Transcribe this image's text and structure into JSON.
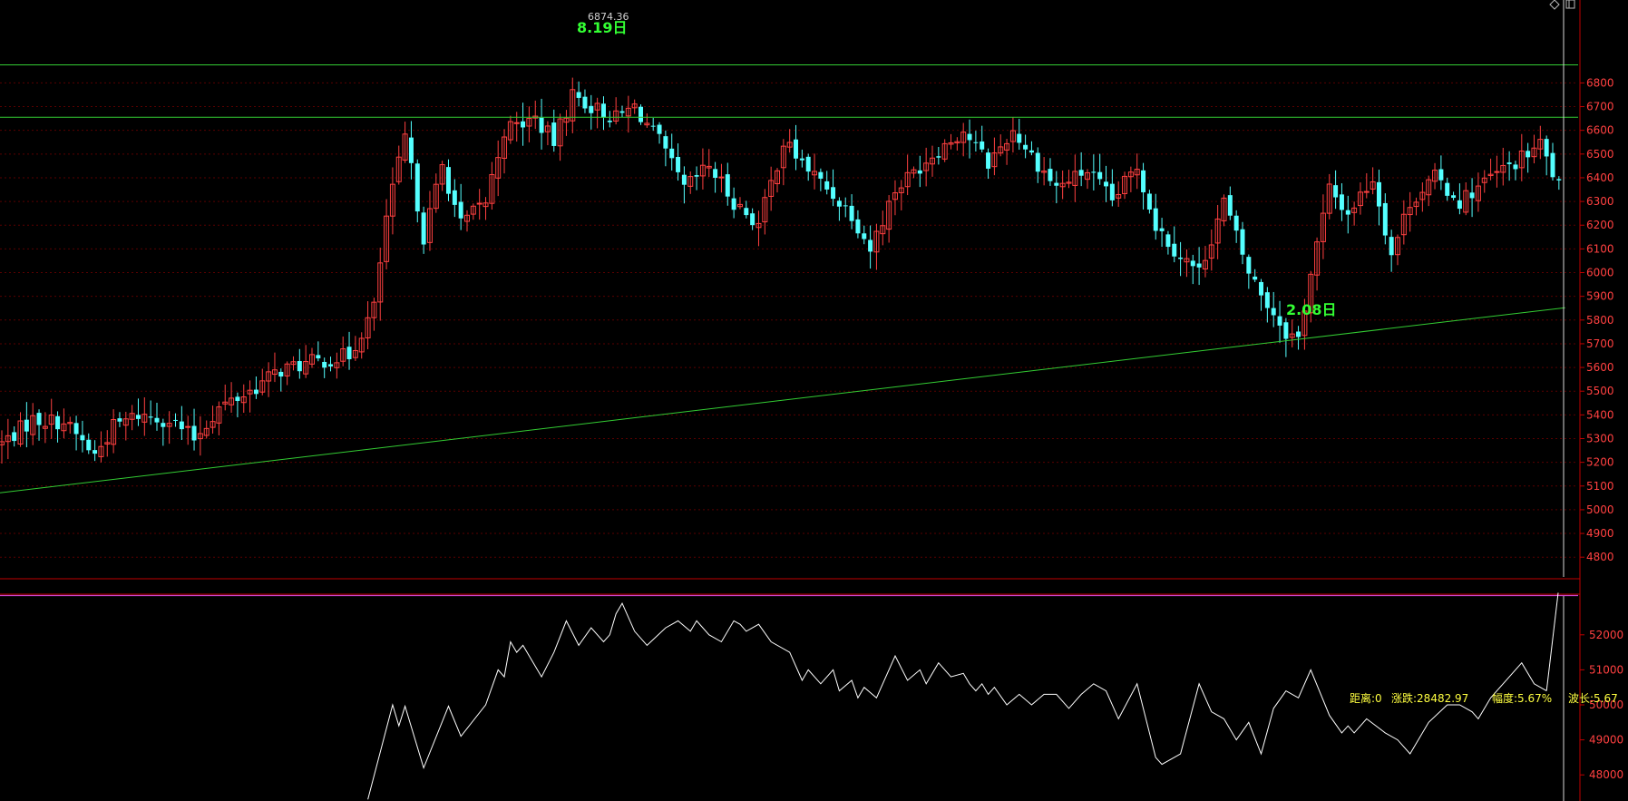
{
  "colors": {
    "background": "#000000",
    "up_candle": "#ff4040",
    "down_candle": "#54ffff",
    "grid": "#5a0000",
    "axis": "#c00000",
    "trend_line": "#33cc33",
    "osc_line": "#ffffff",
    "osc_band": "#cc44cc",
    "tick_text": "#ff4040",
    "annotation": "#33ff33",
    "info_text": "#ffff40"
  },
  "chart_data": [
    {
      "type": "candlestick",
      "y_ticks": [
        4800,
        4900,
        5000,
        5100,
        5200,
        5300,
        5400,
        5500,
        5600,
        5700,
        5800,
        5900,
        6000,
        6100,
        6200,
        6300,
        6400,
        6500,
        6600,
        6700,
        6800
      ],
      "ylim": [
        4570,
        6910
      ],
      "grid": true,
      "annotations": [
        {
          "date_label": "8.19日",
          "price_label": "6874.36",
          "bar_index": 93,
          "price": 6874.36
        },
        {
          "date_label": "2.08日",
          "bar_index": 209,
          "price": 5720
        }
      ],
      "horizontal_lines": [
        6876,
        6655
      ],
      "trend_line": {
        "from": {
          "bar_index": -2,
          "value": 5066
        },
        "to": {
          "bar_index": 252,
          "value": 5852
        }
      },
      "candles": {
        "count": 252,
        "keypoints": [
          [
            0,
            5280
          ],
          [
            5,
            5380
          ],
          [
            10,
            5370
          ],
          [
            15,
            5230
          ],
          [
            18,
            5350
          ],
          [
            22,
            5400
          ],
          [
            27,
            5380
          ],
          [
            31,
            5300
          ],
          [
            35,
            5430
          ],
          [
            40,
            5500
          ],
          [
            45,
            5590
          ],
          [
            50,
            5620
          ],
          [
            56,
            5650
          ],
          [
            60,
            5850
          ],
          [
            62,
            6230
          ],
          [
            65,
            6570
          ],
          [
            68,
            6150
          ],
          [
            71,
            6450
          ],
          [
            74,
            6200
          ],
          [
            78,
            6300
          ],
          [
            81,
            6600
          ],
          [
            86,
            6650
          ],
          [
            89,
            6550
          ],
          [
            92,
            6750
          ],
          [
            95,
            6700
          ],
          [
            99,
            6650
          ],
          [
            102,
            6700
          ],
          [
            106,
            6550
          ],
          [
            110,
            6350
          ],
          [
            114,
            6450
          ],
          [
            118,
            6300
          ],
          [
            122,
            6200
          ],
          [
            126,
            6550
          ],
          [
            132,
            6380
          ],
          [
            137,
            6250
          ],
          [
            140,
            6100
          ],
          [
            144,
            6350
          ],
          [
            150,
            6500
          ],
          [
            155,
            6600
          ],
          [
            159,
            6460
          ],
          [
            163,
            6600
          ],
          [
            167,
            6460
          ],
          [
            170,
            6360
          ],
          [
            175,
            6430
          ],
          [
            179,
            6300
          ],
          [
            183,
            6450
          ],
          [
            186,
            6200
          ],
          [
            189,
            6100
          ],
          [
            193,
            6000
          ],
          [
            197,
            6300
          ],
          [
            201,
            6000
          ],
          [
            204,
            5870
          ],
          [
            207,
            5750
          ],
          [
            209,
            5720
          ],
          [
            211,
            6000
          ],
          [
            214,
            6350
          ],
          [
            217,
            6250
          ],
          [
            221,
            6400
          ],
          [
            224,
            6080
          ],
          [
            227,
            6300
          ],
          [
            231,
            6400
          ],
          [
            235,
            6300
          ],
          [
            240,
            6400
          ],
          [
            245,
            6480
          ],
          [
            248,
            6540
          ],
          [
            251,
            6360
          ]
        ]
      }
    },
    {
      "type": "line",
      "y_ticks": [
        48000,
        49000,
        50000,
        51000,
        52000
      ],
      "ylim": [
        47200,
        53200
      ],
      "reference_line": 53200,
      "points": [
        [
          59,
          47300
        ],
        [
          63,
          50000
        ],
        [
          64,
          49400
        ],
        [
          65,
          49960
        ],
        [
          68,
          48200
        ],
        [
          72,
          49960
        ],
        [
          74,
          49100
        ],
        [
          78,
          50000
        ],
        [
          80,
          51000
        ],
        [
          81,
          50800
        ],
        [
          82,
          51800
        ],
        [
          83,
          51500
        ],
        [
          84,
          51700
        ],
        [
          87,
          50800
        ],
        [
          89,
          51500
        ],
        [
          91,
          52400
        ],
        [
          93,
          51700
        ],
        [
          95,
          52200
        ],
        [
          97,
          51800
        ],
        [
          98,
          52000
        ],
        [
          99,
          52600
        ],
        [
          100,
          52900
        ],
        [
          102,
          52100
        ],
        [
          104,
          51700
        ],
        [
          107,
          52200
        ],
        [
          109,
          52400
        ],
        [
          111,
          52100
        ],
        [
          112,
          52400
        ],
        [
          114,
          52000
        ],
        [
          116,
          51800
        ],
        [
          118,
          52400
        ],
        [
          119,
          52300
        ],
        [
          120,
          52100
        ],
        [
          122,
          52300
        ],
        [
          124,
          51800
        ],
        [
          127,
          51500
        ],
        [
          129,
          50700
        ],
        [
          130,
          51000
        ],
        [
          132,
          50600
        ],
        [
          134,
          51000
        ],
        [
          135,
          50400
        ],
        [
          137,
          50700
        ],
        [
          138,
          50200
        ],
        [
          139,
          50500
        ],
        [
          141,
          50200
        ],
        [
          144,
          51400
        ],
        [
          146,
          50700
        ],
        [
          148,
          51000
        ],
        [
          149,
          50600
        ],
        [
          151,
          51200
        ],
        [
          153,
          50800
        ],
        [
          155,
          50900
        ],
        [
          156,
          50600
        ],
        [
          157,
          50400
        ],
        [
          158,
          50600
        ],
        [
          159,
          50300
        ],
        [
          160,
          50500
        ],
        [
          162,
          50000
        ],
        [
          164,
          50300
        ],
        [
          166,
          50000
        ],
        [
          168,
          50300
        ],
        [
          170,
          50300
        ],
        [
          172,
          49900
        ],
        [
          174,
          50300
        ],
        [
          176,
          50600
        ],
        [
          178,
          50400
        ],
        [
          180,
          49600
        ],
        [
          183,
          50600
        ],
        [
          186,
          48500
        ],
        [
          187,
          48300
        ],
        [
          190,
          48600
        ],
        [
          193,
          50600
        ],
        [
          195,
          49800
        ],
        [
          197,
          49600
        ],
        [
          199,
          49000
        ],
        [
          201,
          49500
        ],
        [
          203,
          48600
        ],
        [
          205,
          49900
        ],
        [
          207,
          50400
        ],
        [
          209,
          50200
        ],
        [
          211,
          51000
        ],
        [
          214,
          49700
        ],
        [
          216,
          49200
        ],
        [
          217,
          49400
        ],
        [
          218,
          49200
        ],
        [
          220,
          49600
        ],
        [
          223,
          49200
        ],
        [
          225,
          49000
        ],
        [
          227,
          48600
        ],
        [
          230,
          49500
        ],
        [
          233,
          50000
        ],
        [
          235,
          50000
        ],
        [
          237,
          49800
        ],
        [
          238,
          49600
        ],
        [
          240,
          50200
        ],
        [
          242,
          50600
        ],
        [
          245,
          51200
        ],
        [
          247,
          50600
        ],
        [
          249,
          50400
        ]
      ],
      "info": {
        "distance": "距离:0",
        "change": "涨跌:28482.97",
        "amplitude": "幅度:5.67%",
        "wavelength": "波长:5.67"
      }
    }
  ]
}
